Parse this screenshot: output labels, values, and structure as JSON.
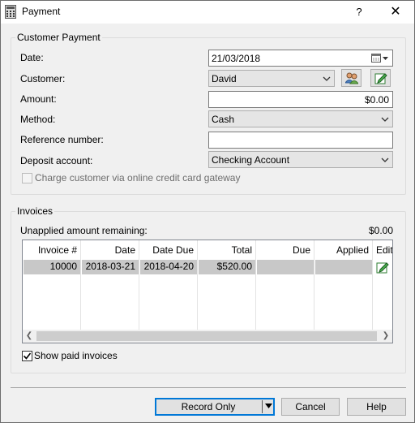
{
  "window": {
    "title": "Payment",
    "help_glyph": "?",
    "close_glyph": "✕"
  },
  "customer_payment": {
    "group_title": "Customer Payment",
    "date_label": "Date:",
    "date_value": "21/03/2018",
    "customer_label": "Customer:",
    "customer_value": "David",
    "amount_label": "Amount:",
    "amount_value": "$0.00",
    "method_label": "Method:",
    "method_value": "Cash",
    "reference_label": "Reference number:",
    "reference_value": "",
    "deposit_label": "Deposit account:",
    "deposit_value": "Checking Account",
    "charge_online_label": "Charge customer via online credit card gateway",
    "charge_online_checked": false
  },
  "invoices": {
    "group_title": "Invoices",
    "unapplied_label": "Unapplied amount remaining:",
    "unapplied_value": "$0.00",
    "columns": [
      "Invoice #",
      "Date",
      "Date Due",
      "Total",
      "Due",
      "Applied",
      "Edit"
    ],
    "rows": [
      {
        "invoice": "10000",
        "date": "2018-03-21",
        "date_due": "2018-04-20",
        "total": "$520.00",
        "due": "",
        "applied": ""
      }
    ],
    "show_paid_label": "Show paid invoices",
    "show_paid_checked": true
  },
  "footer": {
    "record_label": "Record Only",
    "cancel_label": "Cancel",
    "help_label": "Help"
  },
  "colors": {
    "accent": "#0078d7",
    "row_highlight": "#c8c8c8"
  }
}
